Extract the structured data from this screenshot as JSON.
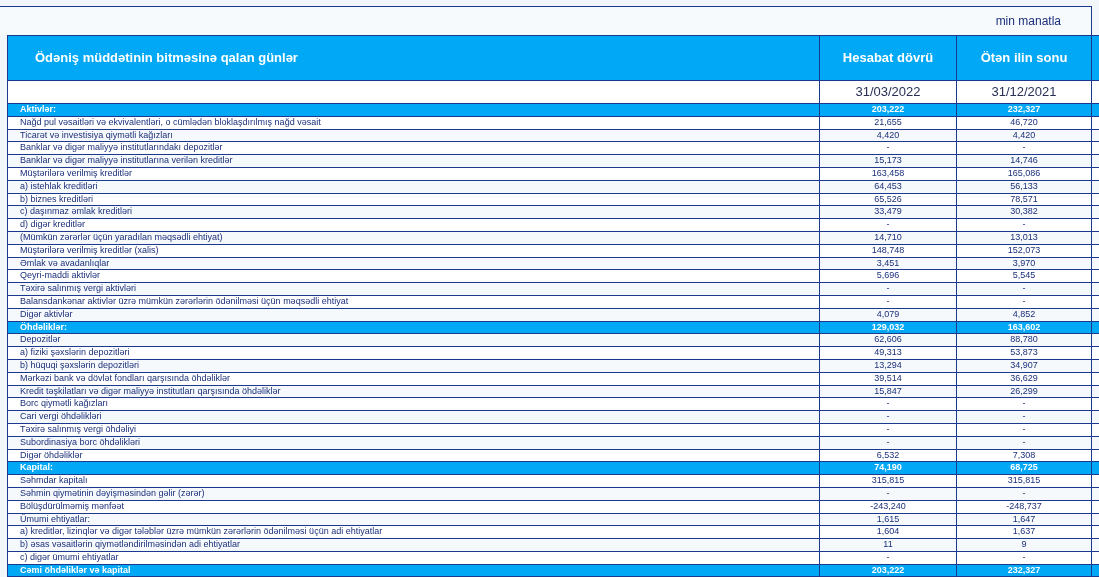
{
  "unit": "min manatla",
  "header": {
    "title": "Ödəniş müddətinin bitməsinə qalan günlər",
    "columns": [
      "Hesabat dövrü",
      "Ötən ilin sonu"
    ],
    "dates": [
      "31/03/2022",
      "31/12/2021"
    ]
  },
  "rows": [
    {
      "kind": "section",
      "label": "Aktivlər:",
      "values": [
        "203,222",
        "232,327"
      ]
    },
    {
      "kind": "item",
      "label": "Nağd pul vəsaitləri və  ekvivalentləri, o cümlədən bloklaşdırılmış nağd vəsait",
      "values": [
        "21,655",
        "46,720"
      ]
    },
    {
      "kind": "item",
      "label": "Ticarət və investisiya qiymətli kağızları",
      "values": [
        "4,420",
        "4,420"
      ]
    },
    {
      "kind": "item",
      "label": "Banklar və digər maliyyə institutlarındakı depozitlər",
      "values": [
        "-",
        "-"
      ]
    },
    {
      "kind": "item",
      "label": "Banklar və digər maliyyə institutlarına verilən kreditlər",
      "values": [
        "15,173",
        "14,746"
      ]
    },
    {
      "kind": "item",
      "label": "Müştərilərə verilmiş kreditlər",
      "values": [
        "163,458",
        "165,086"
      ]
    },
    {
      "kind": "item",
      "label": "a) istehlak kreditləri",
      "values": [
        "64,453",
        "56,133"
      ]
    },
    {
      "kind": "item",
      "label": "b) biznes kreditləri",
      "values": [
        "65,526",
        "78,571"
      ]
    },
    {
      "kind": "item",
      "label": "c) daşınmaz əmlak kreditləri",
      "values": [
        "33,479",
        "30,382"
      ]
    },
    {
      "kind": "item",
      "label": "d) digər kreditlər",
      "values": [
        "-",
        "-"
      ]
    },
    {
      "kind": "item",
      "label": "(Mümkün zərərlər üçün yaradılan məqsədli ehtiyat)",
      "values": [
        "14,710",
        "13,013"
      ]
    },
    {
      "kind": "item",
      "label": "Müştərilərə verilmiş kreditlər (xalis)",
      "values": [
        "148,748",
        "152,073"
      ]
    },
    {
      "kind": "item",
      "label": "Əmlak və avadanlıqlar",
      "values": [
        "3,451",
        "3,970"
      ]
    },
    {
      "kind": "item",
      "label": "Qeyri-maddi aktivlər",
      "values": [
        "5,696",
        "5,545"
      ]
    },
    {
      "kind": "item",
      "label": "Təxirə salınmış vergi aktivləri",
      "values": [
        "-",
        "-"
      ]
    },
    {
      "kind": "item",
      "label": "Balansdankənar aktivlər üzrə mümkün zərərlərin ödənilməsi üçün məqsədli ehtiyat",
      "values": [
        "-",
        "-"
      ]
    },
    {
      "kind": "item",
      "label": "Digər aktivlər",
      "values": [
        "4,079",
        "4,852"
      ]
    },
    {
      "kind": "section",
      "label": "Öhdəliklər:",
      "values": [
        "129,032",
        "163,602"
      ]
    },
    {
      "kind": "item",
      "label": "Depozitlər",
      "values": [
        "62,606",
        "88,780"
      ]
    },
    {
      "kind": "item",
      "label": "a) fiziki şəxslərin depozitləri",
      "values": [
        "49,313",
        "53,873"
      ]
    },
    {
      "kind": "item",
      "label": "b) hüquqi şəxslərin depozitləri",
      "values": [
        "13,294",
        "34,907"
      ]
    },
    {
      "kind": "item",
      "label": "Mərkəzi bank və dövlət fondları qarşısında öhdəliklər",
      "values": [
        "39,514",
        "36,629"
      ]
    },
    {
      "kind": "item",
      "label": "Kredit təşkilatları və digər maliyyə institutları qarşısında öhdəliklər",
      "values": [
        "15,847",
        "26,299"
      ]
    },
    {
      "kind": "item",
      "label": "Borc qiymətli kağızları",
      "values": [
        "-",
        "-"
      ]
    },
    {
      "kind": "item",
      "label": "Cari vergi öhdəlikləri",
      "values": [
        "-",
        "-"
      ]
    },
    {
      "kind": "item",
      "label": "Təxirə salınmış vergi öhdəliyi",
      "values": [
        "-",
        "-"
      ]
    },
    {
      "kind": "item",
      "label": "Subordinasiya borc öhdəlikləri",
      "values": [
        "-",
        "-"
      ]
    },
    {
      "kind": "item",
      "label": "Digər öhdəliklər",
      "values": [
        "6,532",
        "7,308"
      ]
    },
    {
      "kind": "section",
      "label": "Kapital:",
      "values": [
        "74,190",
        "68,725"
      ]
    },
    {
      "kind": "item",
      "label": "Səhmdar kapitalı",
      "values": [
        "315,815",
        "315,815"
      ]
    },
    {
      "kind": "item",
      "label": "Səhmin qiymətinin dəyişməsindən gəlir (zərər)",
      "values": [
        "-",
        "-"
      ]
    },
    {
      "kind": "item",
      "label": "Bölüşdürülməmiş mənfəət",
      "values": [
        "-243,240",
        "-248,737"
      ]
    },
    {
      "kind": "item",
      "label": "Ümumi ehtiyatlar:",
      "values": [
        "1,615",
        "1,647"
      ]
    },
    {
      "kind": "item",
      "label": "a) kreditlər, lizinqlər və digər tələblər üzrə mümkün zərərlərin ödənilməsi üçün adi ehtiyatlar",
      "values": [
        "1,604",
        "1,637"
      ]
    },
    {
      "kind": "item",
      "label": "b) əsas vəsaitlərin qiymətləndirilməsindən adi ehtiyatlar",
      "values": [
        "11",
        "9"
      ]
    },
    {
      "kind": "item",
      "label": "c) digər ümumi ehtiyatlar",
      "values": [
        "-",
        "-"
      ]
    },
    {
      "kind": "section",
      "label": "Cəmi öhdəliklər və kapital",
      "values": [
        "203,222",
        "232,327"
      ]
    }
  ]
}
